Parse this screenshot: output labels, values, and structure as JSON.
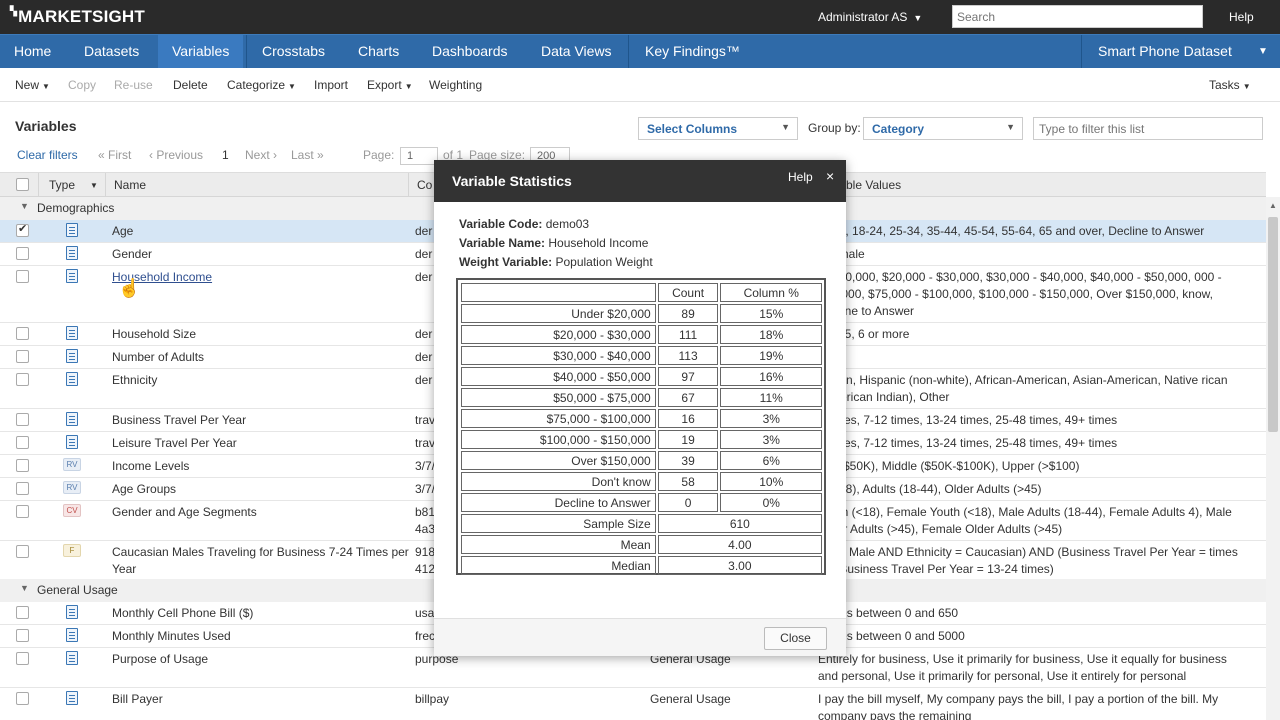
{
  "topbar": {
    "logo": "MARKETSIGHT",
    "user": "Administrator AS",
    "search_placeholder": "Search",
    "help": "Help"
  },
  "nav": {
    "items": [
      "Home",
      "Datasets",
      "Variables",
      "Crosstabs",
      "Charts",
      "Dashboards",
      "Data Views",
      "Key Findings™"
    ],
    "active": "Variables",
    "dataset": "Smart Phone Dataset"
  },
  "toolbar": {
    "new": "New",
    "copy": "Copy",
    "reuse": "Re-use",
    "delete": "Delete",
    "categorize": "Categorize",
    "import": "Import",
    "export": "Export",
    "weighting": "Weighting",
    "tasks": "Tasks"
  },
  "page": {
    "title": "Variables",
    "select_columns": "Select Columns",
    "group_by_label": "Group by:",
    "group_by_value": "Category",
    "filter_placeholder": "Type to filter this list",
    "clear_filters": "Clear filters",
    "pager": {
      "first": "« First",
      "previous": "‹ Previous",
      "current": "1",
      "next": "Next ›",
      "last": "Last »",
      "page_label": "Page:",
      "page_value": "1",
      "of": "of 1",
      "size_label": "Page size:",
      "size_value": "200"
    }
  },
  "table": {
    "headers": {
      "type": "Type",
      "name": "Name",
      "code": "Co",
      "values": "ble Values"
    },
    "groups": [
      {
        "name": "Demographics"
      },
      {
        "name": "General Usage"
      }
    ],
    "rows": [
      {
        "icon": "doc",
        "checked": true,
        "name": "Age",
        "code": "der",
        "cat": "",
        "values": "er 18, 18-24, 25-34, 35-44, 45-54, 55-64, 65 and over, Decline to Answer"
      },
      {
        "icon": "doc",
        "checked": false,
        "name": "Gender",
        "code": "der",
        "cat": "",
        "values": ", Female"
      },
      {
        "icon": "doc",
        "checked": false,
        "name": "Household Income",
        "code": "der",
        "cat": "",
        "values": "er $20,000, $20,000 - $30,000, $30,000 - $40,000, $40,000 - $50,000, 000 - $75,000, $75,000 - $100,000, $100,000 - $150,000, Over $150,000, know, Decline to Answer"
      },
      {
        "icon": "doc",
        "checked": false,
        "name": "Household Size",
        "code": "der",
        "cat": "",
        "values": "3, 4, 5, 6 or more"
      },
      {
        "icon": "doc",
        "checked": false,
        "name": "Number of Adults",
        "code": "der",
        "cat": "",
        "values": "3, 4+"
      },
      {
        "icon": "doc",
        "checked": false,
        "name": "Ethnicity",
        "code": "der",
        "cat": "",
        "values": "casian, Hispanic (non-white), African-American, Asian-American, Native rican (American Indian), Other"
      },
      {
        "icon": "doc",
        "checked": false,
        "name": "Business Travel Per Year",
        "code": "trav",
        "cat": "",
        "values": "6 times, 7-12 times, 13-24 times, 25-48 times, 49+ times"
      },
      {
        "icon": "doc",
        "checked": false,
        "name": "Leisure Travel Per Year",
        "code": "trav",
        "cat": "",
        "values": "6 times, 7-12 times, 13-24 times, 25-48 times, 49+ times"
      },
      {
        "icon": "RV",
        "checked": false,
        "name": "Income Levels",
        "code": "3/7/",
        "cat": "",
        "values": "er (<$50K), Middle ($50K-$100K), Upper (>$100)"
      },
      {
        "icon": "RV",
        "checked": false,
        "name": "Age Groups",
        "code": "3/7/",
        "cat": "",
        "values": "h (<18), Adults (18-44), Older Adults (>45)"
      },
      {
        "icon": "CV",
        "checked": false,
        "name": "Gender and Age Segments",
        "code": "b81 4a3",
        "cat": "",
        "values": "Youth (<18), Female Youth (<18), Male Adults (18-44), Female Adults 4), Male Older Adults (>45), Female Older Adults (>45)"
      },
      {
        "icon": "F",
        "checked": false,
        "name": "Caucasian Males Traveling for Business 7-24 Times per Year",
        "code": "918 412",
        "cat": "",
        "values": "der = Male AND Ethnicity = Caucasian) AND (Business Travel Per Year = times OR Business Travel Per Year = 13-24 times)"
      },
      {
        "icon": "doc",
        "checked": false,
        "name": "Monthly Cell Phone Bill ($)",
        "code": "usa",
        "cat": "",
        "values": "values between 0 and 650"
      },
      {
        "icon": "doc",
        "checked": false,
        "name": "Monthly Minutes Used",
        "code": "frec",
        "cat": "",
        "values": "values between 0 and 5000"
      },
      {
        "icon": "doc",
        "checked": false,
        "name": "Purpose of Usage",
        "code": "purpose",
        "cat": "General Usage",
        "values": "Entirely for business, Use it primarily for business, Use it equally for business and personal, Use it primarily for personal, Use it entirely for personal"
      },
      {
        "icon": "doc",
        "checked": false,
        "name": "Bill Payer",
        "code": "billpay",
        "cat": "General Usage",
        "values": "I pay the bill myself, My company pays the bill, I pay a portion of the bill. My company pays the remaining"
      }
    ]
  },
  "modal": {
    "title": "Variable Statistics",
    "help": "Help",
    "close_x": "×",
    "code_label": "Variable Code:",
    "code_value": "demo03",
    "name_label": "Variable Name:",
    "name_value": "Household Income",
    "weight_label": "Weight Variable:",
    "weight_value": "Population Weight",
    "col_count": "Count",
    "col_pct": "Column %",
    "rows": [
      {
        "label": "Under $20,000",
        "count": "89",
        "pct": "15%"
      },
      {
        "label": "$20,000 - $30,000",
        "count": "111",
        "pct": "18%"
      },
      {
        "label": "$30,000 - $40,000",
        "count": "113",
        "pct": "19%"
      },
      {
        "label": "$40,000 - $50,000",
        "count": "97",
        "pct": "16%"
      },
      {
        "label": "$50,000 - $75,000",
        "count": "67",
        "pct": "11%"
      },
      {
        "label": "$75,000 - $100,000",
        "count": "16",
        "pct": "3%"
      },
      {
        "label": "$100,000 - $150,000",
        "count": "19",
        "pct": "3%"
      },
      {
        "label": "Over $150,000",
        "count": "39",
        "pct": "6%"
      },
      {
        "label": "Don't know",
        "count": "58",
        "pct": "10%"
      },
      {
        "label": "Decline to Answer",
        "count": "0",
        "pct": "0%"
      }
    ],
    "summary": [
      {
        "label": "Sample Size",
        "value": "610"
      },
      {
        "label": "Mean",
        "value": "4.00"
      },
      {
        "label": "Median",
        "value": "3.00"
      }
    ],
    "close_button": "Close"
  }
}
